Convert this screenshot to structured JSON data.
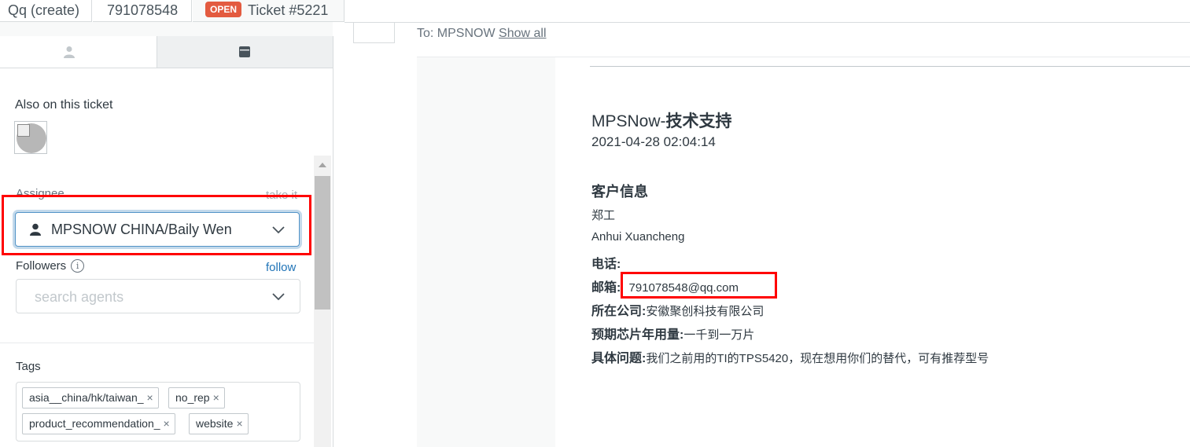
{
  "tabs": [
    {
      "label": "Qq (create)"
    },
    {
      "label": "791078548"
    },
    {
      "badge": "OPEN",
      "label": "Ticket #5221"
    }
  ],
  "sidebar": {
    "also_on_ticket": "Also on this ticket",
    "assignee_label": "Assignee",
    "take_it": "take it",
    "assignee_value": "MPSNOW CHINA/Baily Wen",
    "followers_label": "Followers",
    "info_glyph": "i",
    "follow": "follow",
    "followers_placeholder": "search agents",
    "tags_label": "Tags",
    "tags": [
      "asia__china/hk/taiwan_",
      "no_rep",
      "product_recommendation_",
      "website"
    ],
    "tag_remove_glyph": "×"
  },
  "conversation": {
    "to_prefix": "To: MPSNOW",
    "show_all": "Show all"
  },
  "email": {
    "title_brand": "MPSNow-",
    "title_rest": "技术支持",
    "datetime": "2021-04-28 02:04:14",
    "customer_heading": "客户信息",
    "name": "郑工",
    "location": "Anhui  Xuancheng",
    "phone_label": "电话:",
    "email_label": "邮箱:",
    "email_value": "791078548@qq.com",
    "company_label": "所在公司:",
    "company_value": "安徽聚创科技有限公司",
    "volume_label": "预期芯片年用量:",
    "volume_value": "一千到一万片",
    "issue_label": "具体问题:",
    "issue_value": "我们之前用的TI的TPS5420，现在想用你们的替代，可有推荐型号"
  },
  "colors": {
    "accent_blue": "#1f73b7",
    "open_badge": "#e35b40",
    "highlight_red": "#ff0000"
  }
}
